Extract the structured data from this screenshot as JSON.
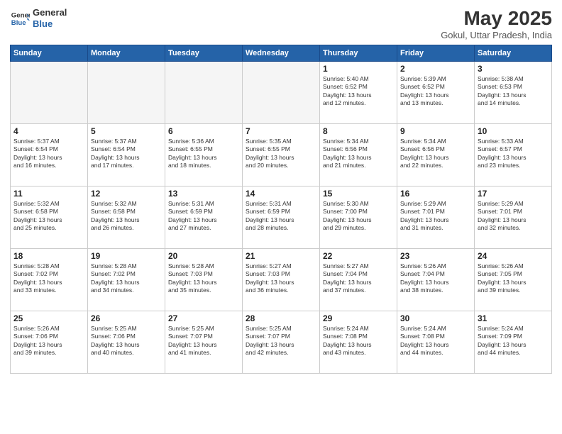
{
  "header": {
    "logo_line1": "General",
    "logo_line2": "Blue",
    "month": "May 2025",
    "location": "Gokul, Uttar Pradesh, India"
  },
  "weekdays": [
    "Sunday",
    "Monday",
    "Tuesday",
    "Wednesday",
    "Thursday",
    "Friday",
    "Saturday"
  ],
  "weeks": [
    [
      {
        "day": "",
        "data": ""
      },
      {
        "day": "",
        "data": ""
      },
      {
        "day": "",
        "data": ""
      },
      {
        "day": "",
        "data": ""
      },
      {
        "day": "1",
        "data": "Sunrise: 5:40 AM\nSunset: 6:52 PM\nDaylight: 13 hours\nand 12 minutes."
      },
      {
        "day": "2",
        "data": "Sunrise: 5:39 AM\nSunset: 6:52 PM\nDaylight: 13 hours\nand 13 minutes."
      },
      {
        "day": "3",
        "data": "Sunrise: 5:38 AM\nSunset: 6:53 PM\nDaylight: 13 hours\nand 14 minutes."
      }
    ],
    [
      {
        "day": "4",
        "data": "Sunrise: 5:37 AM\nSunset: 6:54 PM\nDaylight: 13 hours\nand 16 minutes."
      },
      {
        "day": "5",
        "data": "Sunrise: 5:37 AM\nSunset: 6:54 PM\nDaylight: 13 hours\nand 17 minutes."
      },
      {
        "day": "6",
        "data": "Sunrise: 5:36 AM\nSunset: 6:55 PM\nDaylight: 13 hours\nand 18 minutes."
      },
      {
        "day": "7",
        "data": "Sunrise: 5:35 AM\nSunset: 6:55 PM\nDaylight: 13 hours\nand 20 minutes."
      },
      {
        "day": "8",
        "data": "Sunrise: 5:34 AM\nSunset: 6:56 PM\nDaylight: 13 hours\nand 21 minutes."
      },
      {
        "day": "9",
        "data": "Sunrise: 5:34 AM\nSunset: 6:56 PM\nDaylight: 13 hours\nand 22 minutes."
      },
      {
        "day": "10",
        "data": "Sunrise: 5:33 AM\nSunset: 6:57 PM\nDaylight: 13 hours\nand 23 minutes."
      }
    ],
    [
      {
        "day": "11",
        "data": "Sunrise: 5:32 AM\nSunset: 6:58 PM\nDaylight: 13 hours\nand 25 minutes."
      },
      {
        "day": "12",
        "data": "Sunrise: 5:32 AM\nSunset: 6:58 PM\nDaylight: 13 hours\nand 26 minutes."
      },
      {
        "day": "13",
        "data": "Sunrise: 5:31 AM\nSunset: 6:59 PM\nDaylight: 13 hours\nand 27 minutes."
      },
      {
        "day": "14",
        "data": "Sunrise: 5:31 AM\nSunset: 6:59 PM\nDaylight: 13 hours\nand 28 minutes."
      },
      {
        "day": "15",
        "data": "Sunrise: 5:30 AM\nSunset: 7:00 PM\nDaylight: 13 hours\nand 29 minutes."
      },
      {
        "day": "16",
        "data": "Sunrise: 5:29 AM\nSunset: 7:01 PM\nDaylight: 13 hours\nand 31 minutes."
      },
      {
        "day": "17",
        "data": "Sunrise: 5:29 AM\nSunset: 7:01 PM\nDaylight: 13 hours\nand 32 minutes."
      }
    ],
    [
      {
        "day": "18",
        "data": "Sunrise: 5:28 AM\nSunset: 7:02 PM\nDaylight: 13 hours\nand 33 minutes."
      },
      {
        "day": "19",
        "data": "Sunrise: 5:28 AM\nSunset: 7:02 PM\nDaylight: 13 hours\nand 34 minutes."
      },
      {
        "day": "20",
        "data": "Sunrise: 5:28 AM\nSunset: 7:03 PM\nDaylight: 13 hours\nand 35 minutes."
      },
      {
        "day": "21",
        "data": "Sunrise: 5:27 AM\nSunset: 7:03 PM\nDaylight: 13 hours\nand 36 minutes."
      },
      {
        "day": "22",
        "data": "Sunrise: 5:27 AM\nSunset: 7:04 PM\nDaylight: 13 hours\nand 37 minutes."
      },
      {
        "day": "23",
        "data": "Sunrise: 5:26 AM\nSunset: 7:04 PM\nDaylight: 13 hours\nand 38 minutes."
      },
      {
        "day": "24",
        "data": "Sunrise: 5:26 AM\nSunset: 7:05 PM\nDaylight: 13 hours\nand 39 minutes."
      }
    ],
    [
      {
        "day": "25",
        "data": "Sunrise: 5:26 AM\nSunset: 7:06 PM\nDaylight: 13 hours\nand 39 minutes."
      },
      {
        "day": "26",
        "data": "Sunrise: 5:25 AM\nSunset: 7:06 PM\nDaylight: 13 hours\nand 40 minutes."
      },
      {
        "day": "27",
        "data": "Sunrise: 5:25 AM\nSunset: 7:07 PM\nDaylight: 13 hours\nand 41 minutes."
      },
      {
        "day": "28",
        "data": "Sunrise: 5:25 AM\nSunset: 7:07 PM\nDaylight: 13 hours\nand 42 minutes."
      },
      {
        "day": "29",
        "data": "Sunrise: 5:24 AM\nSunset: 7:08 PM\nDaylight: 13 hours\nand 43 minutes."
      },
      {
        "day": "30",
        "data": "Sunrise: 5:24 AM\nSunset: 7:08 PM\nDaylight: 13 hours\nand 44 minutes."
      },
      {
        "day": "31",
        "data": "Sunrise: 5:24 AM\nSunset: 7:09 PM\nDaylight: 13 hours\nand 44 minutes."
      }
    ]
  ]
}
